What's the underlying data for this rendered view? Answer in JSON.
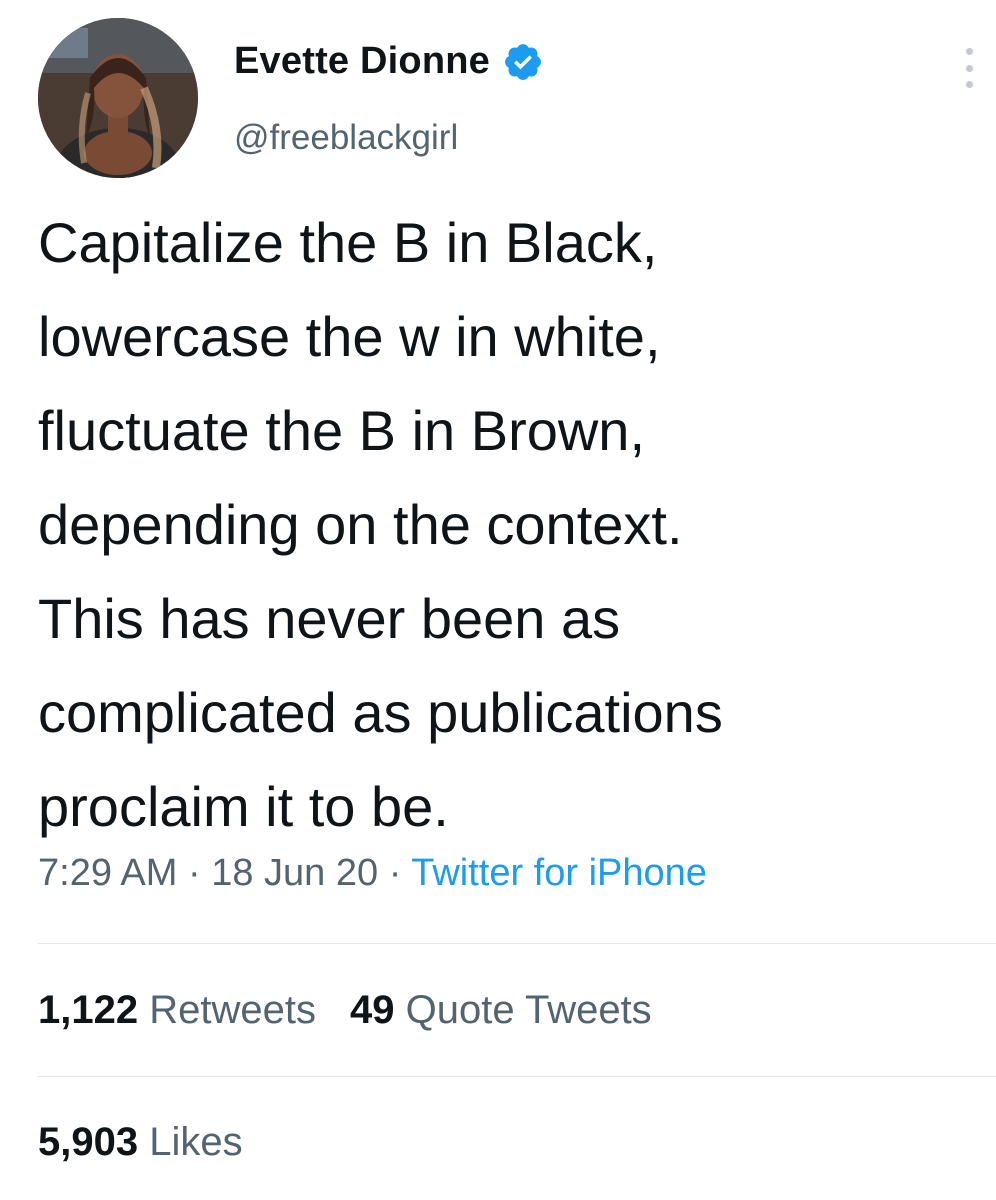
{
  "author": {
    "display_name": "Evette Dionne",
    "handle": "@freeblackgirl",
    "verified_icon": "verified-badge-icon",
    "avatar_icon": "profile-photo"
  },
  "tweet": {
    "lines": [
      "Capitalize the B in Black,",
      "lowercase the w in white,",
      "fluctuate the B in Brown,",
      "depending on the context.",
      "This has never been as",
      "complicated as publications",
      "proclaim it to be."
    ],
    "time": "7:29 AM",
    "date": "18 Jun 20",
    "separator": "·",
    "source": "Twitter for iPhone"
  },
  "stats": {
    "retweets_count": "1,122",
    "retweets_label": "Retweets",
    "quotes_count": "49",
    "quotes_label": "Quote Tweets",
    "likes_count": "5,903",
    "likes_label": "Likes"
  },
  "colors": {
    "text": "#0f1419",
    "secondary": "#536471",
    "link": "#1d9bf0",
    "verified": "#1d9bf0",
    "divider": "#e1e6ea"
  }
}
